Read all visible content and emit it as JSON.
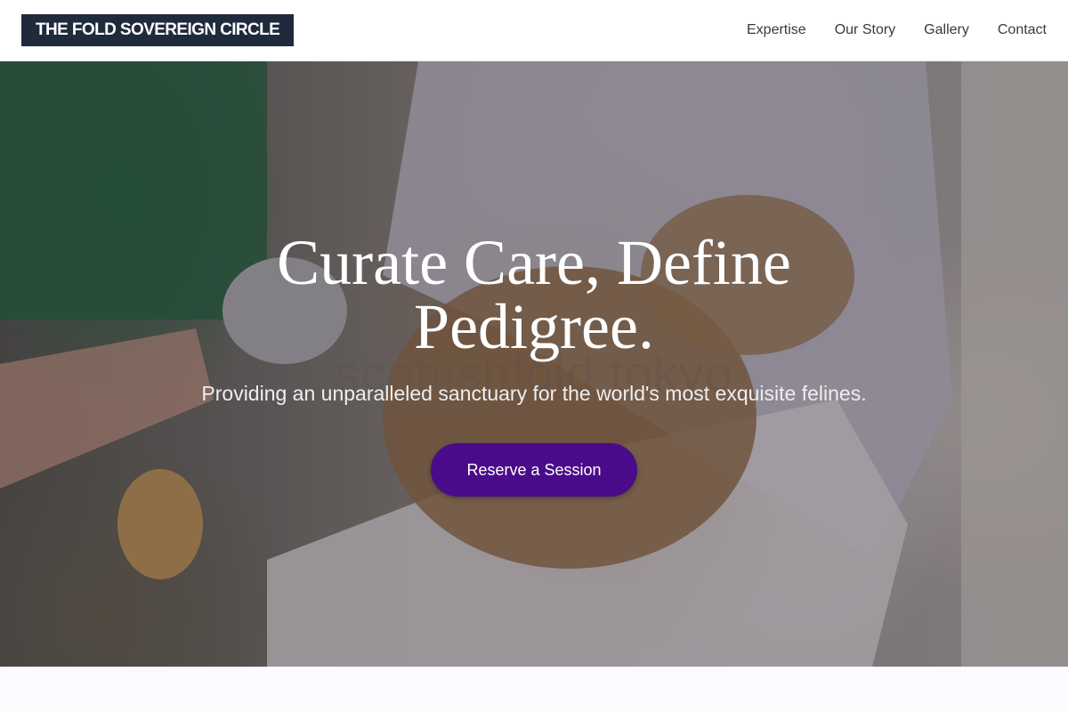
{
  "header": {
    "logo": "THE FOLD SOVEREIGN CIRCLE",
    "nav": [
      {
        "label": "Expertise"
      },
      {
        "label": "Our Story"
      },
      {
        "label": "Gallery"
      },
      {
        "label": "Contact"
      }
    ]
  },
  "hero": {
    "title": "Curate Care, Define Pedigree.",
    "watermark": "scottishfold tokyo",
    "subtitle": "Providing an unparalleled sanctuary for the world's most exquisite felines.",
    "cta_label": "Reserve a Session",
    "background_image": "grooming-photo"
  },
  "colors": {
    "logo_bg": "#1f2a3c",
    "cta_bg": "#4a0b8a",
    "page_bg": "#fcfaff"
  }
}
